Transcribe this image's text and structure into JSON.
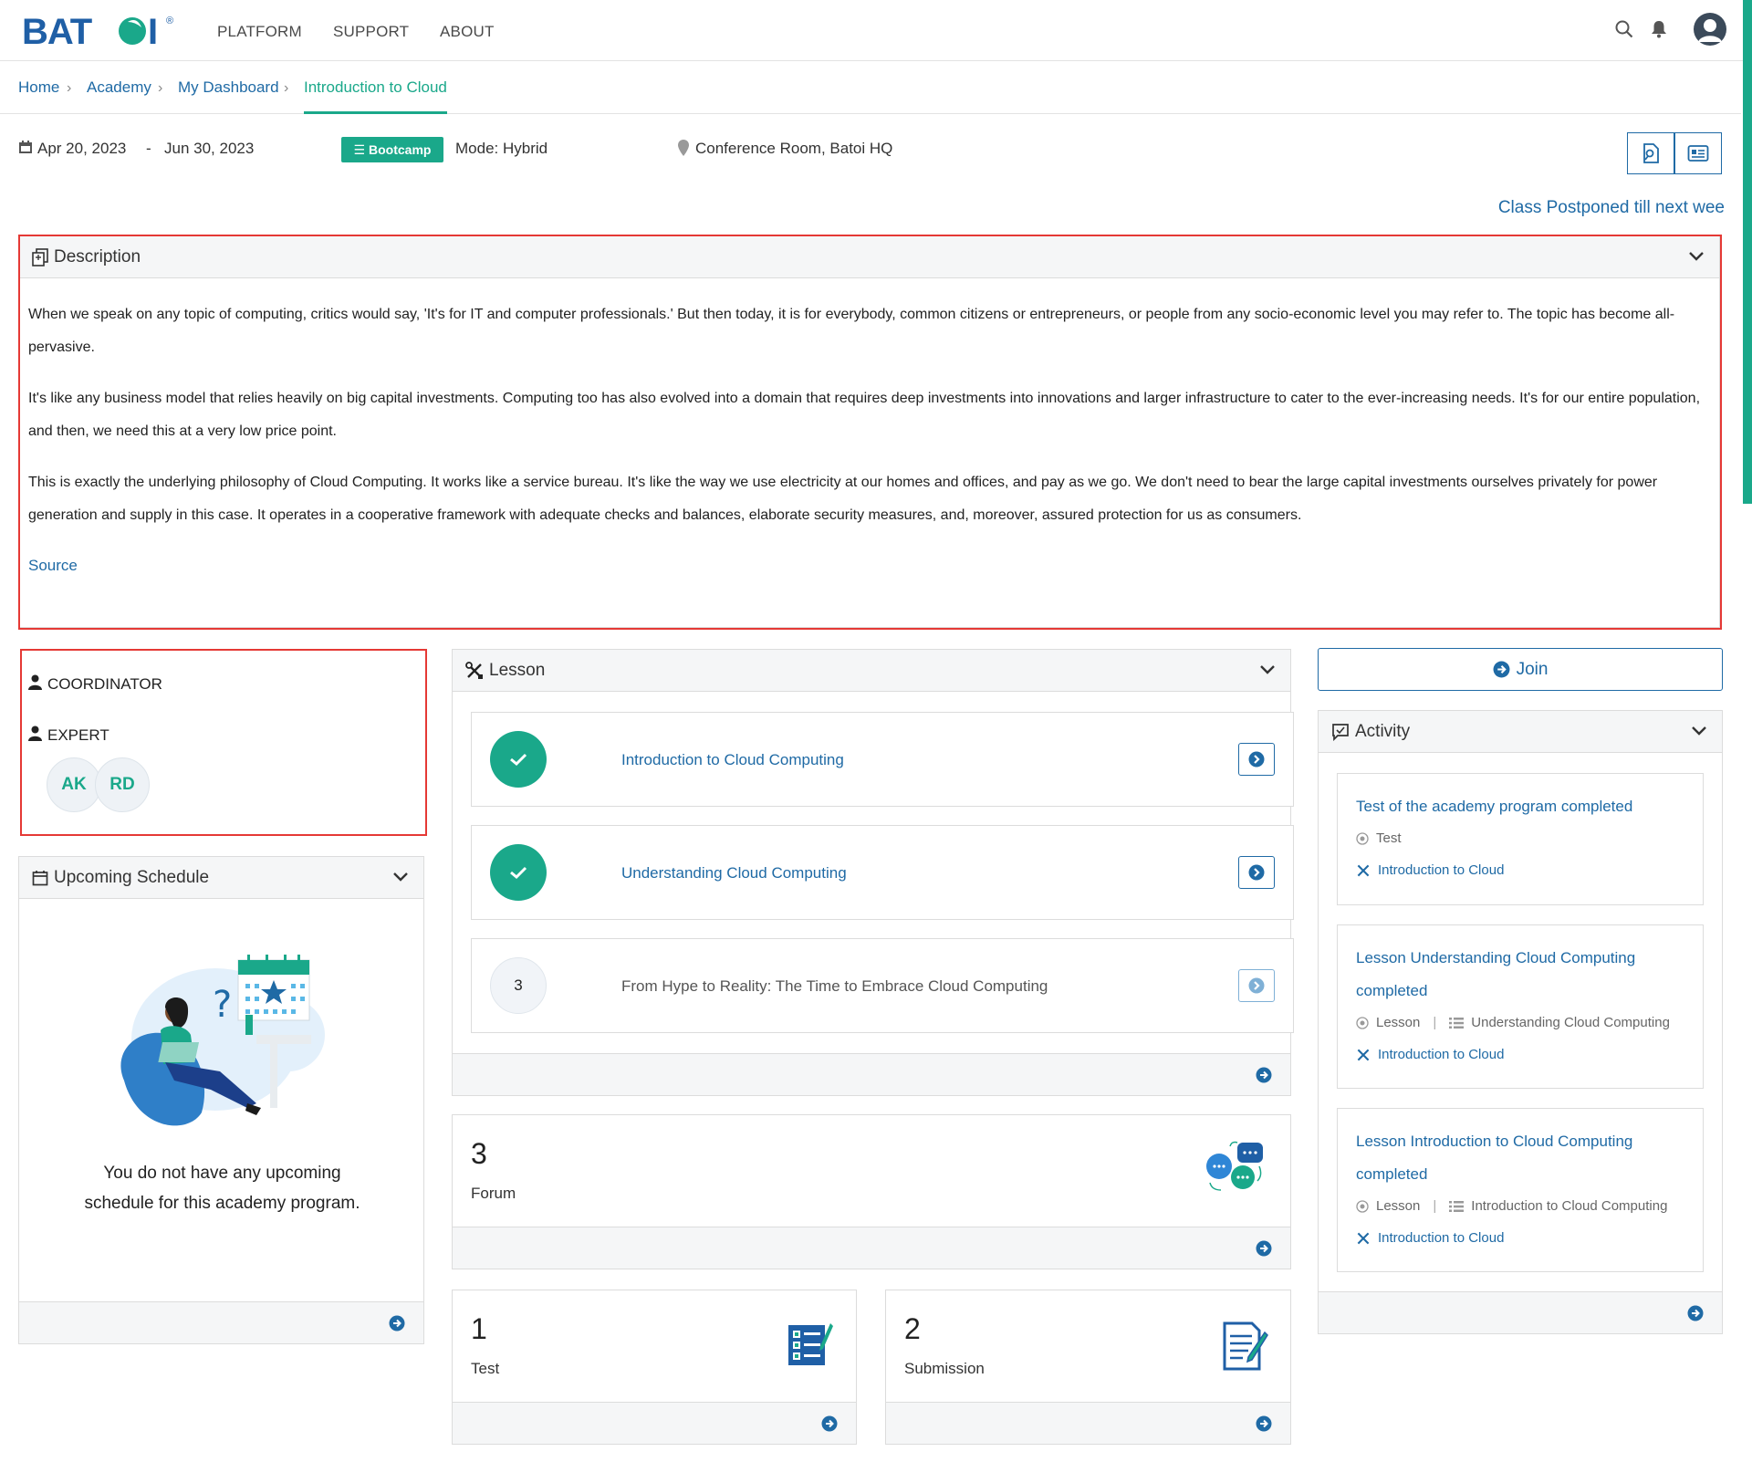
{
  "header": {
    "brand": "BATOI",
    "nav": [
      "PLATFORM",
      "SUPPORT",
      "ABOUT"
    ]
  },
  "breadcrumb": [
    "Home",
    "Academy",
    "My Dashboard",
    "Introduction to Cloud"
  ],
  "meta": {
    "start_date": "Apr 20, 2023",
    "separator": "-",
    "end_date": "Jun 30, 2023",
    "badge": "Bootcamp",
    "mode": "Mode: Hybrid",
    "location": "Conference Room, Batoi HQ"
  },
  "notice": "Class Postponed till next wee",
  "description": {
    "title": "Description",
    "paragraphs": [
      "When we speak on any topic of computing, critics would say, 'It's for IT and computer professionals.' But then today, it is for everybody, common citizens or entrepreneurs, or people from any socio-economic level you may refer to. The topic has become all-pervasive.",
      "It's like any business model that relies heavily on big capital investments. Computing too has also evolved into a domain that requires deep investments into innovations and larger infrastructure to cater to the ever-increasing needs. It's for our entire population, and then, we need this at a very low price point.",
      "This is exactly the underlying philosophy of Cloud Computing. It works like a service bureau. It's like the way we use electricity at our homes and offices, and pay as we go. We don't need to bear the large capital investments ourselves privately for power generation and supply in this case. It operates in a cooperative framework with adequate checks and balances, elaborate security measures, and, moreover, assured protection for us as consumers."
    ],
    "source_link": "Source"
  },
  "people": {
    "coordinator_label": "COORDINATOR",
    "expert_label": "EXPERT",
    "experts": [
      "AK",
      "RD"
    ]
  },
  "schedule": {
    "title": "Upcoming Schedule",
    "empty_message": "You do not have any upcoming schedule for this academy program."
  },
  "lesson": {
    "title": "Lesson",
    "items": [
      {
        "status": "completed",
        "marker": "",
        "title": "Introduction to Cloud Computing"
      },
      {
        "status": "completed",
        "marker": "",
        "title": "Understanding Cloud Computing"
      },
      {
        "status": "pending",
        "marker": "3",
        "title": "From Hype to Reality: The Time to Embrace Cloud Computing"
      }
    ]
  },
  "stats": {
    "forum": {
      "count": "3",
      "label": "Forum"
    },
    "test": {
      "count": "1",
      "label": "Test"
    },
    "submission": {
      "count": "2",
      "label": "Submission"
    }
  },
  "join_label": "Join",
  "activity": {
    "title": "Activity",
    "items": [
      {
        "title": "Test of the academy program completed",
        "type": "Test",
        "detail": "",
        "program": "Introduction to Cloud"
      },
      {
        "title": "Lesson Understanding Cloud Computing completed",
        "type": "Lesson",
        "detail": "Understanding Cloud Computing",
        "program": "Introduction to Cloud"
      },
      {
        "title": "Lesson Introduction to Cloud Computing completed",
        "type": "Lesson",
        "detail": "Introduction to Cloud Computing",
        "program": "Introduction to Cloud"
      }
    ]
  },
  "colors": {
    "accent_green": "#1aa88a",
    "link_blue": "#1f6aa5",
    "highlight_red": "#e53935"
  }
}
